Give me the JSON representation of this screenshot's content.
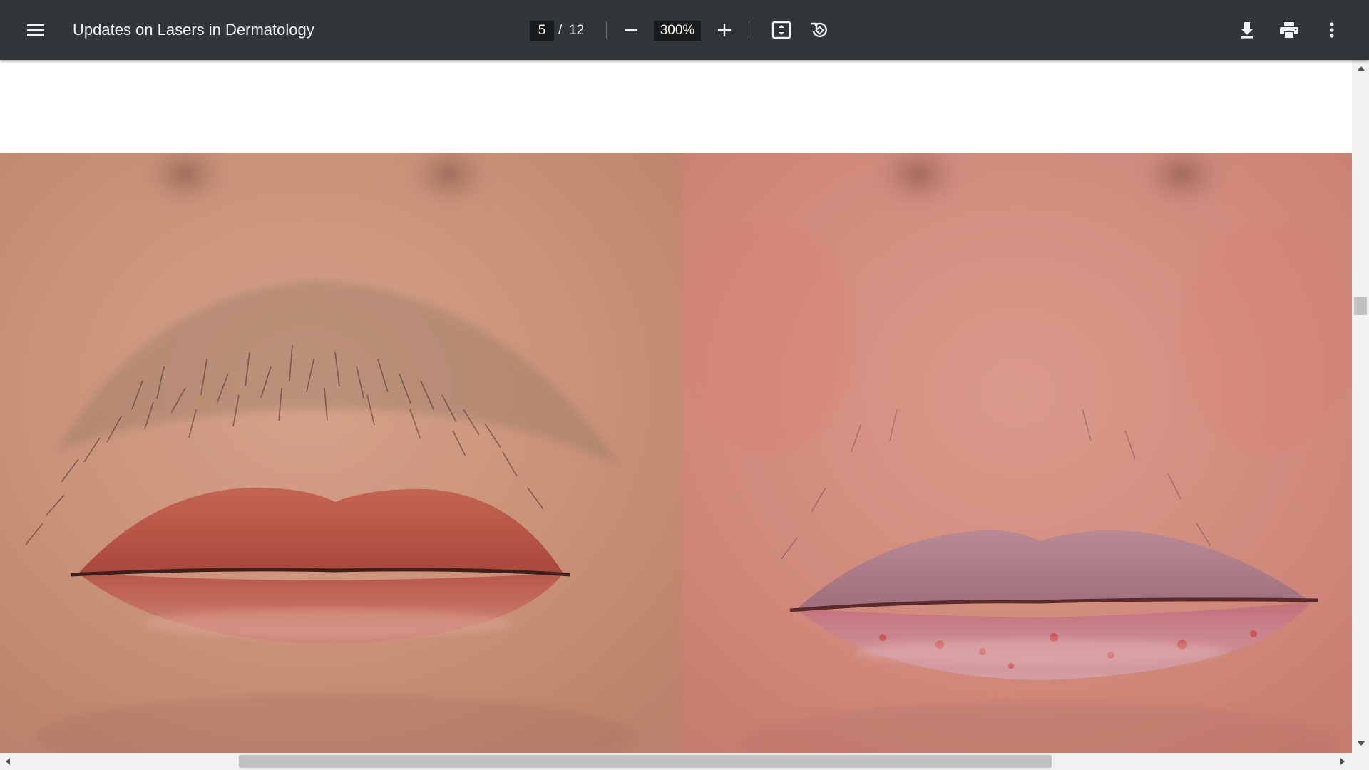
{
  "toolbar": {
    "menu_icon": "hamburger-menu-icon",
    "title": "Updates on Lasers in Dermatology",
    "page": {
      "current": "5",
      "separator": "/",
      "total": "12"
    },
    "zoom": {
      "value": "300%",
      "zoom_out_icon": "minus-icon",
      "zoom_in_icon": "plus-icon"
    },
    "fit_icon": "fit-to-page-icon",
    "rotate_icon": "rotate-counterclockwise-icon",
    "download_icon": "download-icon",
    "print_icon": "print-icon",
    "more_icon": "more-vertical-icon"
  },
  "document": {
    "page_content": "before-and-after-photo-upper-lip",
    "panels": [
      "before-photo",
      "after-photo"
    ]
  },
  "colors": {
    "toolbar_bg": "#323639",
    "toolbar_text": "#f1f3f4",
    "input_bg": "#191b1c",
    "scrollbar_track": "#f1f1f1",
    "scrollbar_thumb": "#c1c1c1"
  },
  "scrollbars": {
    "vertical_position_fraction": 0.32,
    "horizontal_position_fraction": 0.2,
    "horizontal_visible_fraction": 0.6
  }
}
